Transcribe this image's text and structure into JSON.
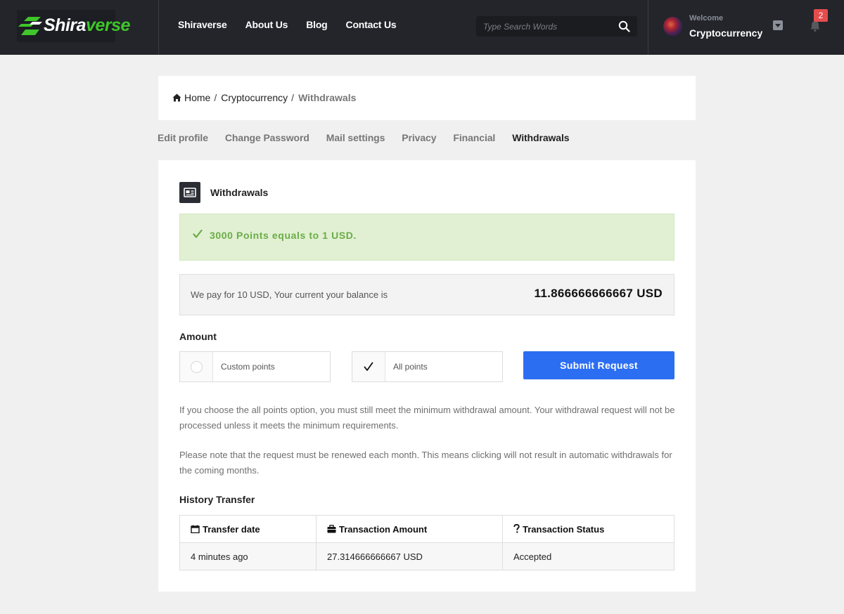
{
  "header": {
    "logo": {
      "text_part1": "Shira",
      "text_part2": "verse"
    },
    "nav": [
      "Shiraverse",
      "About Us",
      "Blog",
      "Contact Us"
    ],
    "search_placeholder": "Type Search Words",
    "welcome": "Welcome",
    "username": "Cryptocurrency",
    "notification_count": "2"
  },
  "breadcrumb": {
    "home": "Home",
    "separator": "/",
    "parent": "Cryptocurrency",
    "current": "Withdrawals"
  },
  "tabs": [
    "Edit profile",
    "Change Password",
    "Mail settings",
    "Privacy",
    "Financial",
    "Withdrawals"
  ],
  "active_tab": "Withdrawals",
  "section": {
    "title": "Withdrawals",
    "alert": "3000 Points equals to 1 USD.",
    "balance_text": "We pay for 10 USD, Your current your balance is",
    "balance_value": "11.866666666667 USD",
    "amount_label": "Amount",
    "option_custom": "Custom points",
    "option_all": "All points",
    "submit_label": "Submit Request",
    "note1": "If you choose the all points option, you must still meet the minimum withdrawal amount. Your withdrawal request will not be processed unless it meets the minimum requirements.",
    "note2": "Please note that the request must be renewed each month. This means clicking will not result in automatic withdrawals for the coming months.",
    "history_title": "History Transfer",
    "table": {
      "headers": [
        "Transfer date",
        "Transaction Amount",
        "Transaction Status"
      ],
      "rows": [
        [
          "4 minutes ago",
          "27.314666666667 USD",
          "Accepted"
        ]
      ]
    }
  },
  "colors": {
    "header_bg": "#23252b",
    "brand_green": "#3ec62a",
    "alert_bg": "#e1f0d2",
    "alert_text": "#6aac47",
    "primary_button": "#2c6ef2",
    "badge": "#e44d4d"
  },
  "icons": {
    "logo": "shiraverse-logo-icon",
    "search": "search-icon",
    "avatar": "user-avatar",
    "dropdown": "chevron-down-icon",
    "notifications": "bell-icon",
    "home": "home-icon",
    "section": "id-card-icon",
    "alert": "check-icon",
    "date": "calendar-icon",
    "amount": "briefcase-icon",
    "status": "question-icon"
  }
}
